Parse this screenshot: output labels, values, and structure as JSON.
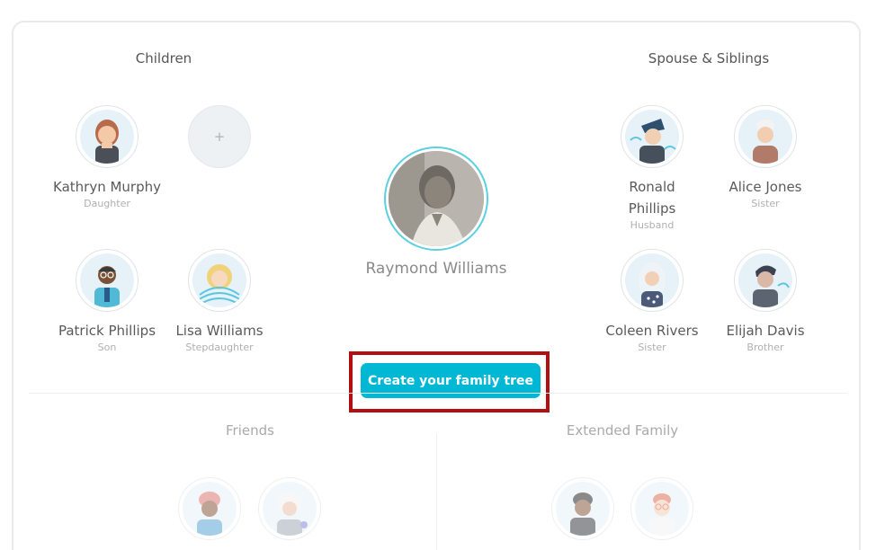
{
  "sections": {
    "children": "Children",
    "spouse_siblings": "Spouse & Siblings",
    "friends": "Friends",
    "extended_family": "Extended Family"
  },
  "main_person": {
    "name": "Raymond Williams"
  },
  "children": [
    {
      "name": "Kathryn Murphy",
      "relation": "Daughter"
    },
    {
      "name": "Patrick Phillips",
      "relation": "Son"
    },
    {
      "name": "Lisa Williams",
      "relation": "Stepdaughter"
    }
  ],
  "add_child": {
    "label": "+"
  },
  "spouse_siblings": [
    {
      "name": "Ronald Phillips",
      "relation": "Husband"
    },
    {
      "name": "Alice Jones",
      "relation": "Sister"
    },
    {
      "name": "Coleen Rivers",
      "relation": "Sister"
    },
    {
      "name": "Elijah Davis",
      "relation": "Brother"
    }
  ],
  "cta": {
    "label": "Create your family tree"
  },
  "colors": {
    "accent": "#00b8d4",
    "highlight": "#b30f12",
    "ring": "#5bd0e0"
  }
}
